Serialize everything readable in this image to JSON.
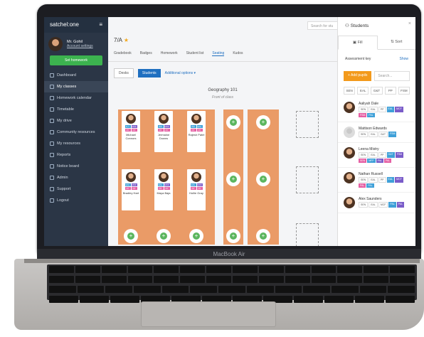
{
  "laptop": {
    "brand": "MacBook Air"
  },
  "sidebar": {
    "logo": "satchel:one",
    "menu_icon": "hamburger-icon",
    "user_name": "Mr. Gohil",
    "account_link": "Account settings",
    "set_homework": "Set homework",
    "items": [
      {
        "label": "Dashboard",
        "active": false
      },
      {
        "label": "My classes",
        "active": true
      },
      {
        "label": "Homework calendar",
        "active": false
      },
      {
        "label": "Timetable",
        "active": false
      },
      {
        "label": "My drive",
        "active": false
      },
      {
        "label": "Community resources",
        "active": false
      },
      {
        "label": "My resources",
        "active": false
      },
      {
        "label": "Reports",
        "active": false
      },
      {
        "label": "Notice board",
        "active": false
      },
      {
        "label": "Admin",
        "active": false
      },
      {
        "label": "Support",
        "active": false
      },
      {
        "label": "Logout",
        "active": false
      }
    ]
  },
  "header": {
    "search_placeholder": "Search for stu",
    "class_name": "7/A",
    "tabs": [
      "Gradebook",
      "Badges",
      "Homework",
      "Student list",
      "Seating",
      "Kudos"
    ],
    "active_tab": "Seating"
  },
  "toolbar": {
    "desks": "Desks",
    "students": "Students",
    "options": "Additional options ▾"
  },
  "seating": {
    "title": "Geography 101",
    "front": "Front of class",
    "row1": [
      {
        "name": "Michael Connors",
        "tags": [
          "N.Y",
          "MCF",
          "PP",
          "PP"
        ]
      },
      {
        "name": "Jermaine Downs",
        "tags": [
          "ISC",
          "MCF",
          "PP",
          "PP"
        ]
      },
      {
        "name": "Rajesh Patel",
        "tags": [
          "ISC",
          "EAL",
          "PP",
          "PP"
        ]
      }
    ],
    "row2": [
      {
        "name": "Bradley Hart",
        "tags": [
          "EAL",
          "MCF",
          "PP",
          "PP"
        ]
      },
      {
        "name": "Maya Baja",
        "tags": [
          "EAL",
          "MCF",
          "PP",
          "PP"
        ]
      },
      {
        "name": "Hollie Gray",
        "tags": [
          "EAL",
          "MCF",
          "PP",
          "PP"
        ]
      }
    ]
  },
  "panel": {
    "title": "Students",
    "close": "×",
    "tab_fill": "Fill",
    "tab_sort": "Sort",
    "assessment_key": "Assessment key",
    "show": "Show",
    "add_pupils": "+ Add pupils",
    "search_placeholder": "Search...",
    "filters": [
      "SEN",
      "EAL",
      "G&T",
      "PP",
      "FSM"
    ],
    "students": [
      {
        "name": "Aaliyah Dale",
        "chips": [
          "SEN",
          "EAL",
          "PP",
          "EAL",
          "MCF",
          "FSM",
          "PAL"
        ],
        "photo": true
      },
      {
        "name": "Mattison Edwards",
        "chips": [
          "SEN",
          "EAL",
          "G&T",
          "FSM"
        ],
        "photo": false
      },
      {
        "name": "Leena Mistry",
        "chips": [
          "SEN",
          "EAL",
          "PP",
          "G&T",
          "FSM",
          "SEN",
          "MFP",
          "PAL",
          "PAL"
        ],
        "photo": true
      },
      {
        "name": "Nathan Russell",
        "chips": [
          "SEN",
          "EAL",
          "PP",
          "EAL",
          "MCF",
          "PAL",
          "PAL"
        ],
        "photo": true
      },
      {
        "name": "Alex Saunders",
        "chips": [
          "SEN",
          "EAL",
          "MCF",
          "PAL",
          "PAL"
        ],
        "photo": true
      }
    ]
  },
  "colors": {
    "accent": "#1f6fc0",
    "table": "#ea9b67",
    "green": "#3cb34f",
    "orange": "#f39a1c"
  }
}
